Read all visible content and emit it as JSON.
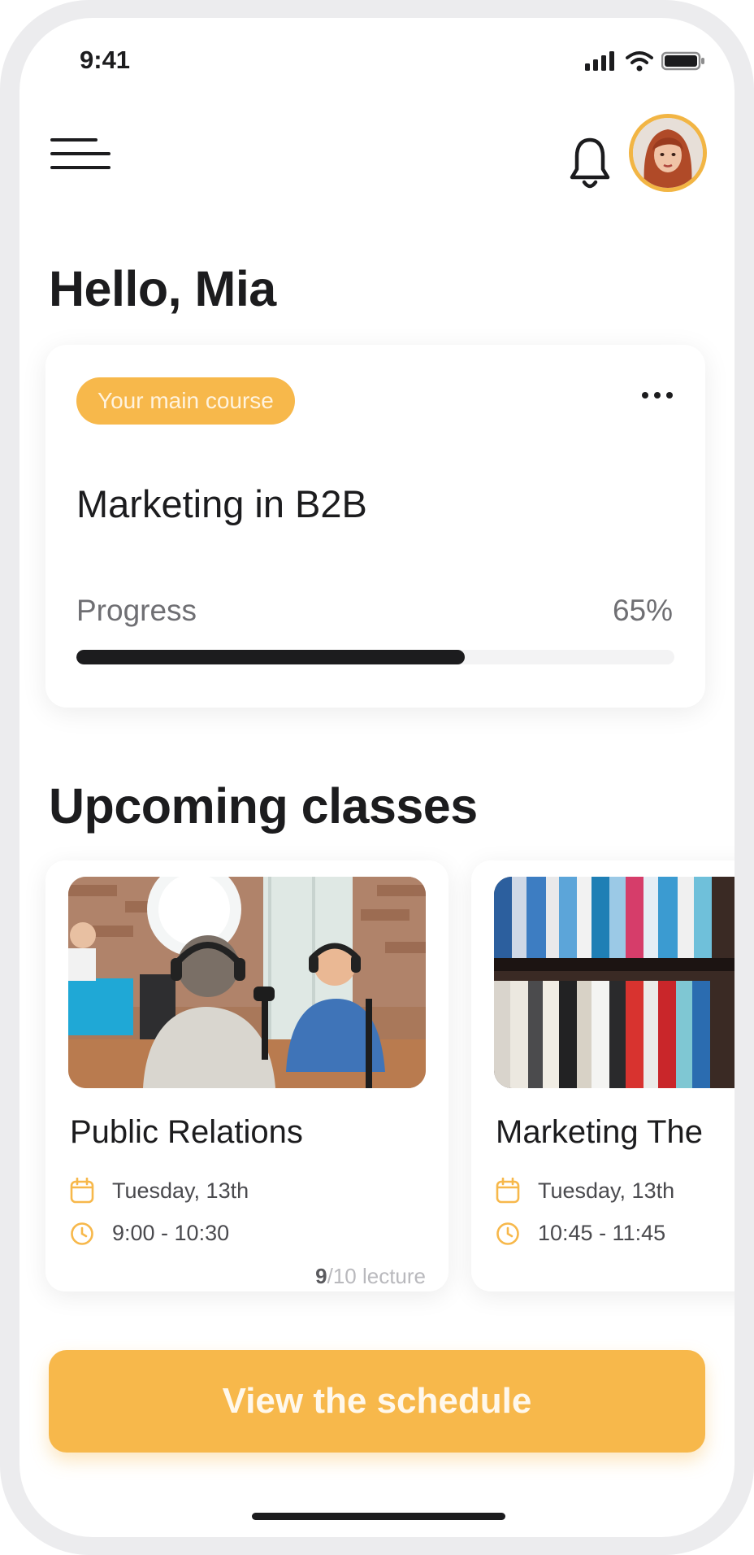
{
  "status_bar": {
    "time": "9:41"
  },
  "header": {
    "menu_icon": "hamburger-icon",
    "bell_icon": "bell-icon",
    "avatar": "user-avatar"
  },
  "greeting": "Hello, Mia",
  "main_course": {
    "badge": "Your main course",
    "title": "Marketing in B2B",
    "progress_label": "Progress",
    "progress_text": "65%",
    "progress_value": 0.65
  },
  "upcoming": {
    "title": "Upcoming classes",
    "classes": [
      {
        "name": "Public Relations",
        "date": "Tuesday, 13th",
        "time": "9:00 - 10:30",
        "lecture_current": "9",
        "lecture_rest": "/10 lecture"
      },
      {
        "name": "Marketing The",
        "date": "Tuesday, 13th",
        "time": "10:45 - 11:45"
      }
    ]
  },
  "cta": {
    "label": "View the schedule"
  },
  "colors": {
    "accent": "#f7b84b",
    "text": "#1c1c1e",
    "muted": "#6f6f73",
    "background": "#ffffff"
  }
}
